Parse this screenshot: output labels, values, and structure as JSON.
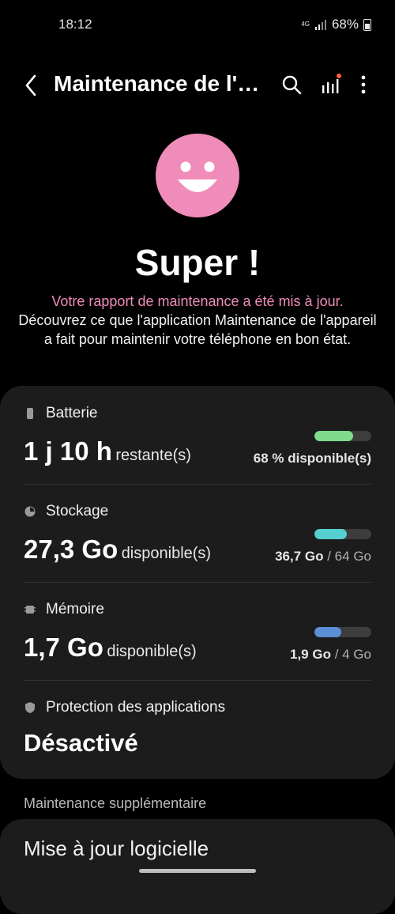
{
  "status_bar": {
    "time": "18:12",
    "network_label": "4G",
    "battery_percent": "68%",
    "icons": [
      "network-4g-icon",
      "signal-icon",
      "battery-icon"
    ]
  },
  "app_bar": {
    "title": "Maintenance de l'appareil",
    "icons": [
      "back-icon",
      "search-icon",
      "report-icon",
      "more-icon"
    ]
  },
  "hero": {
    "face_color": "#f08cba",
    "headline": "Super !",
    "subtitle_pink": "Votre rapport de maintenance a été mis à jour.",
    "subtitle_white": "Découvrez ce que l'application Maintenance de l'appareil a fait pour maintenir votre téléphone en bon état."
  },
  "sections": {
    "battery": {
      "label": "Batterie",
      "value": "1 j 10 h",
      "unit": "restante(s)",
      "info": "68 % disponible(s)",
      "level": 0.68,
      "color": "#7fdc8c"
    },
    "storage": {
      "label": "Stockage",
      "value": "27,3 Go",
      "unit": "disponible(s)",
      "used": "36,7 Go",
      "total": "/ 64 Go",
      "level": 0.57,
      "color": "#55cfcf"
    },
    "memory": {
      "label": "Mémoire",
      "value": "1,7 Go",
      "unit": "disponible(s)",
      "used": "1,9 Go",
      "total": "/ 4 Go",
      "level": 0.475,
      "color": "#5b8fd6"
    },
    "protection": {
      "label": "Protection des applications",
      "value": "Désactivé"
    }
  },
  "extra": {
    "header": "Maintenance supplémentaire",
    "software_update": "Mise à jour logicielle"
  }
}
